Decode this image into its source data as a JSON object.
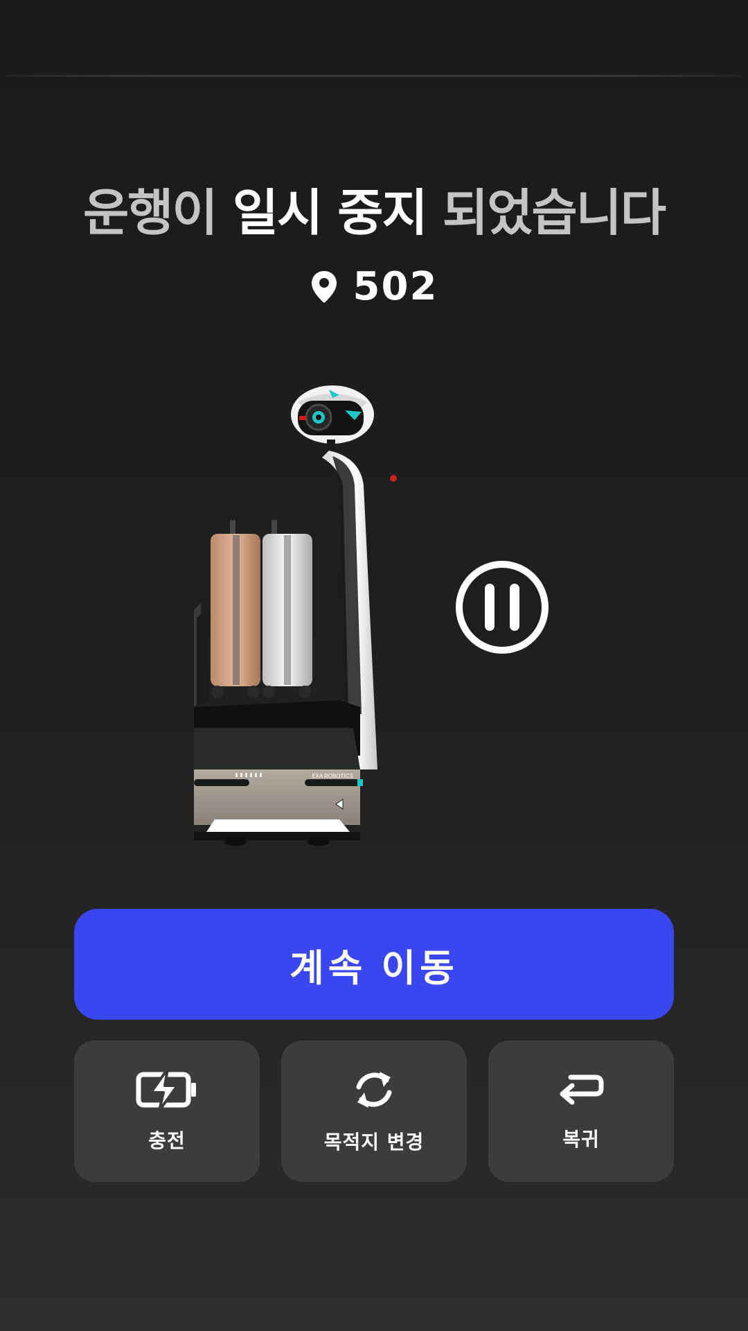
{
  "header": {
    "title_prefix": "운행이",
    "title_emphasis": "일시 중지",
    "title_suffix": "되었습니다"
  },
  "location": {
    "icon": "map-pin-icon",
    "room": "502"
  },
  "status": {
    "icon": "pause-circle-icon"
  },
  "robot": {
    "brand_text": "EXA ROBOTICS"
  },
  "primary_action": {
    "label": "계속 이동"
  },
  "actions": [
    {
      "icon": "battery-charging-icon",
      "label": "충전"
    },
    {
      "icon": "refresh-icon",
      "label": "목적지 변경"
    },
    {
      "icon": "return-arrow-icon",
      "label": "복귀"
    }
  ],
  "colors": {
    "background": "#1c1c1c",
    "primary_button": "#3a46ee",
    "secondary_button": "#3c3c3c",
    "text_primary": "#ffffff",
    "text_dim": "#c4c4c4"
  }
}
